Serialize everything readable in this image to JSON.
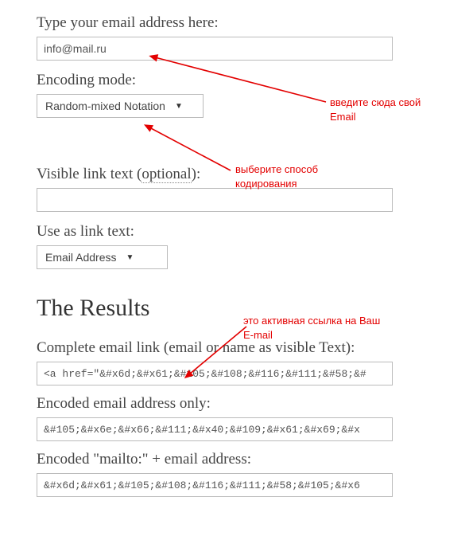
{
  "labels": {
    "email": "Type your email address here:",
    "encoding": "Encoding mode:",
    "visible_pre": "Visible link text (",
    "visible_opt": "optional",
    "visible_post": "):",
    "use_as": "Use as link text:",
    "complete": "Complete email link (email or name as visible Text):",
    "encoded_only": "Encoded email address only:",
    "encoded_mailto": "Encoded \"mailto:\" + email address:"
  },
  "heading": {
    "results": "The Results"
  },
  "inputs": {
    "email": "info@mail.ru",
    "encoding_selected": "Random-mixed Notation",
    "visible_text": "",
    "use_as_selected": "Email Address",
    "complete_link": "<a href=\"&#x6d;&#x61;&#105;&#108;&#116;&#111;&#58;&#",
    "encoded_only": "&#105;&#x6e;&#x66;&#111;&#x40;&#109;&#x61;&#x69;&#x",
    "encoded_mailto": "&#x6d;&#x61;&#105;&#108;&#116;&#111;&#58;&#105;&#x6"
  },
  "annotations": {
    "a1": "введите сюда свой Email",
    "a2": "выберите способ кодирования",
    "a3": "это активная ссылка на Ваш E-mail"
  }
}
